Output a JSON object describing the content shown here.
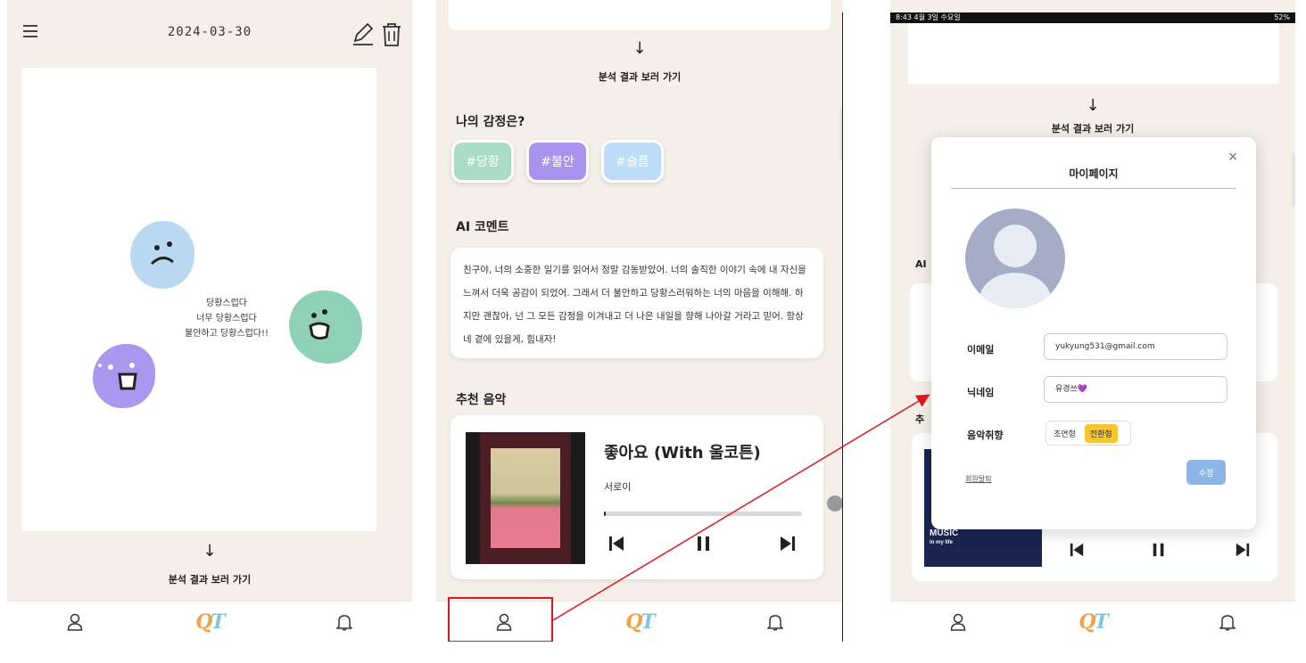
{
  "diary": {
    "date": "2024-03-30",
    "entry_lines": [
      "당황스럽다",
      "너무 당황스럽다",
      "불안하고 당황스럽다!!"
    ],
    "goto_label": "분석 결과 보러 가기"
  },
  "analysis": {
    "goto_label": "분석 결과 보러 가기",
    "emotions_title": "나의 감정은?",
    "tags": [
      "#당황",
      "#불안",
      "#슬픔"
    ],
    "comment_title": "AI 코멘트",
    "comment_text": "친구야, 너의 소중한 일기를 읽어서 정말 감동받았어. 너의 솔직한 이야기 속에 내 자신을 느껴서 더욱 공감이 되었어. 그래서 더 불안하고 당황스러워하는 너의 마음을 이해해. 하지만 괜찮아, 넌 그 모든 감정을 이겨내고 더 나은 내일을 향해 나아갈 거라고 믿어. 항상 네 곁에 있을게, 힘내자!",
    "music_title": "추천 음악",
    "song_title": "좋아요 (With 울코튼)",
    "artist": "서로이",
    "progress": 0.01
  },
  "mypage": {
    "status_left": "8:43  4월 3일 수요일",
    "status_right": "52%",
    "goto_label": "분석 결과 보러 가기",
    "title": "마이페이지",
    "close": "×",
    "email_label": "이메일",
    "email_value": "yukyung531@gmail.com",
    "nickname_label": "닉네임",
    "nickname_value": "유경쓰💜",
    "music_pref_label": "음악취향",
    "pref_options": [
      "조연형",
      "전환형"
    ],
    "pref_selected": "전환형",
    "withdraw_label": "회원탈퇴",
    "save_label": "수정",
    "thumb_label": "MUSIC",
    "thumb_sub": "in my life",
    "bg_ai": "AI",
    "bg_music": "추"
  },
  "nav": {
    "logo_q": "Q",
    "logo_t": "T"
  },
  "colors": {
    "background": "#f4efe9",
    "highlight": "#e0161b",
    "save_button": "#8db6e8",
    "toggle_on": "#f7c62f"
  }
}
